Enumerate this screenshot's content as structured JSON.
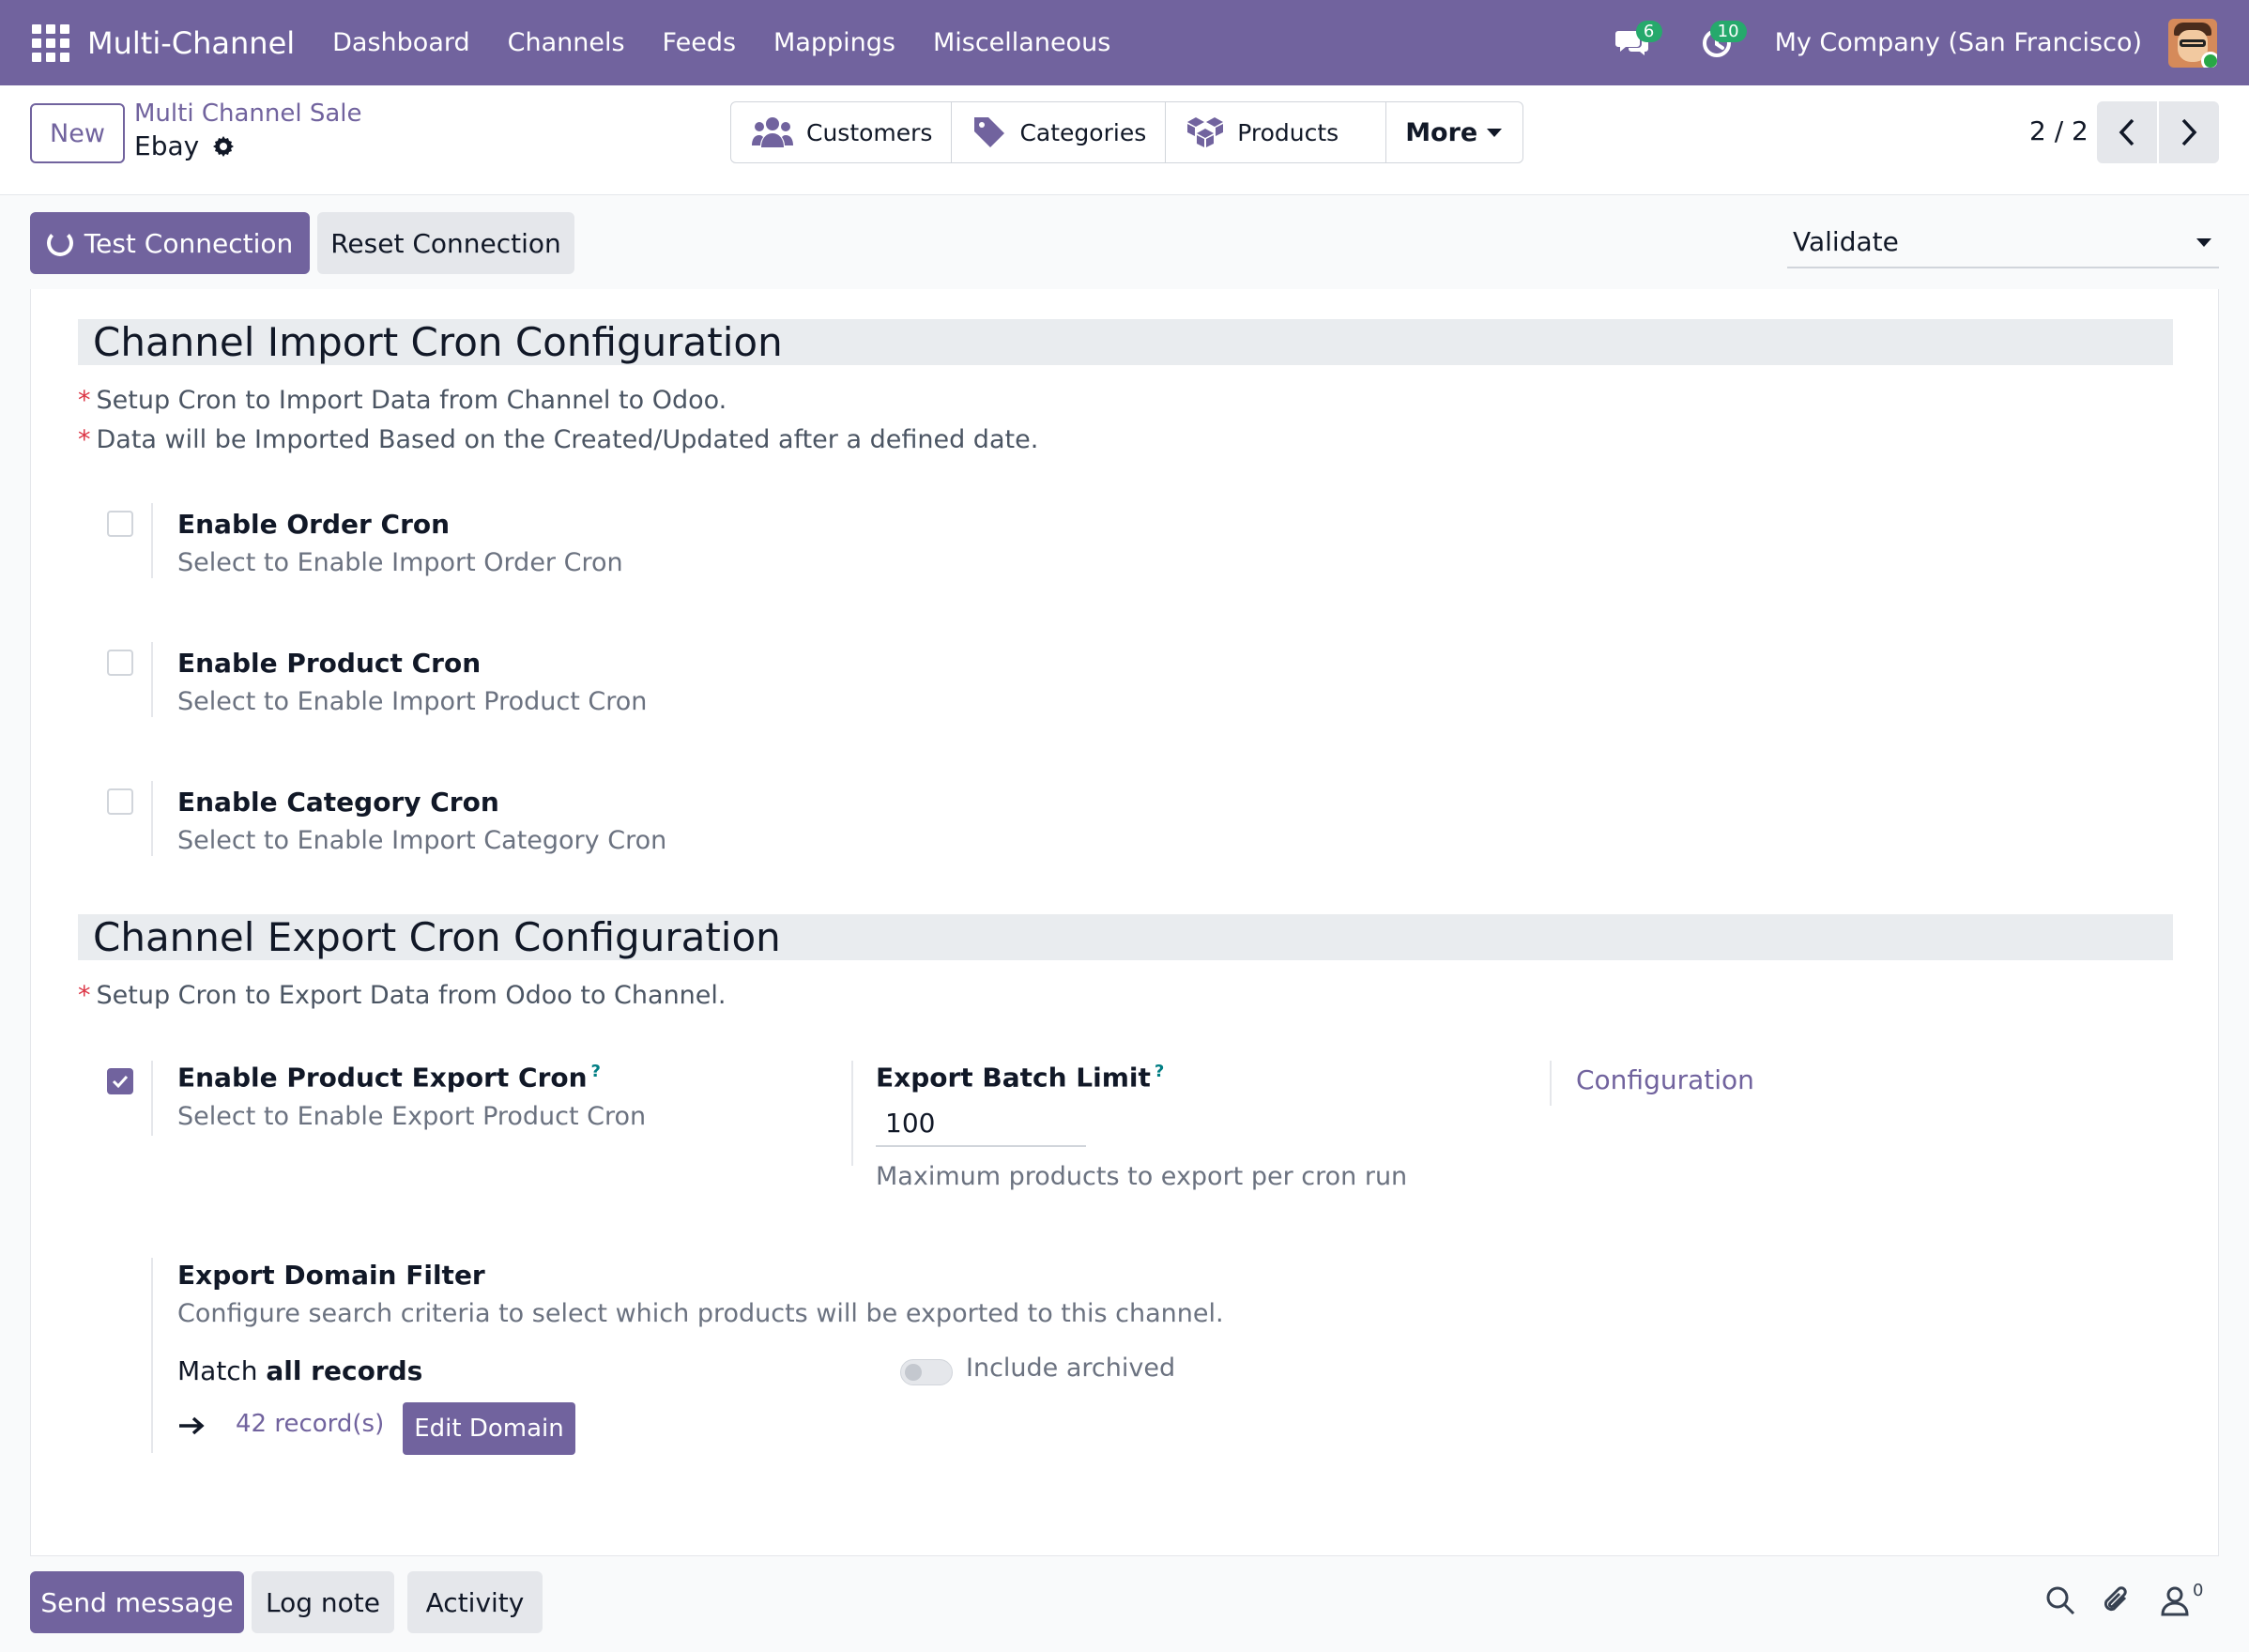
{
  "navbar": {
    "app_name": "Multi-Channel",
    "menu": [
      "Dashboard",
      "Channels",
      "Feeds",
      "Mappings",
      "Miscellaneous"
    ],
    "messages_count": "6",
    "activities_count": "10",
    "company": "My Company (San Francisco)"
  },
  "control": {
    "new_label": "New",
    "breadcrumb_parent": "Multi Channel Sale",
    "record_title": "Ebay",
    "smart_buttons": [
      "Customers",
      "Categories",
      "Products",
      "More"
    ],
    "pager": "2 / 2"
  },
  "statusbar": {
    "test_connection": "Test Connection",
    "reset_connection": "Reset Connection",
    "state_value": "Validate"
  },
  "import_section": {
    "title": "Channel Import Cron Configuration",
    "notes": [
      "Setup Cron to Import Data from Channel to Odoo.",
      "Data will be Imported Based on the Created/Updated after a defined date."
    ],
    "fields": [
      {
        "label": "Enable Order Cron",
        "desc": "Select to Enable Import Order Cron",
        "checked": false
      },
      {
        "label": "Enable Product Cron",
        "desc": "Select to Enable Import Product Cron",
        "checked": false
      },
      {
        "label": "Enable Category Cron",
        "desc": "Select to Enable Import Category Cron",
        "checked": false
      }
    ]
  },
  "export_section": {
    "title": "Channel Export Cron Configuration",
    "note": "Setup Cron to Export Data from Odoo to Channel.",
    "product_export": {
      "label": "Enable Product Export Cron",
      "help": "?",
      "desc": "Select to Enable Export Product Cron",
      "checked": true
    },
    "batch_limit": {
      "label": "Export Batch Limit",
      "help": "?",
      "value": "100",
      "desc": "Maximum products to export per cron run"
    },
    "configuration_link": "Configuration",
    "domain_filter": {
      "label": "Export Domain Filter",
      "desc": "Configure search criteria to select which products will be exported to this channel.",
      "match_prefix": "Match",
      "match_bold": "all records",
      "include_archived": "Include archived",
      "records": "42 record(s)",
      "edit_domain": "Edit Domain"
    }
  },
  "chatter": {
    "send_message": "Send message",
    "log_note": "Log note",
    "activity": "Activity",
    "followers_count": "0"
  },
  "colors": {
    "brand": "#71639e",
    "badge": "#26a96c",
    "required": "#dc3545"
  }
}
